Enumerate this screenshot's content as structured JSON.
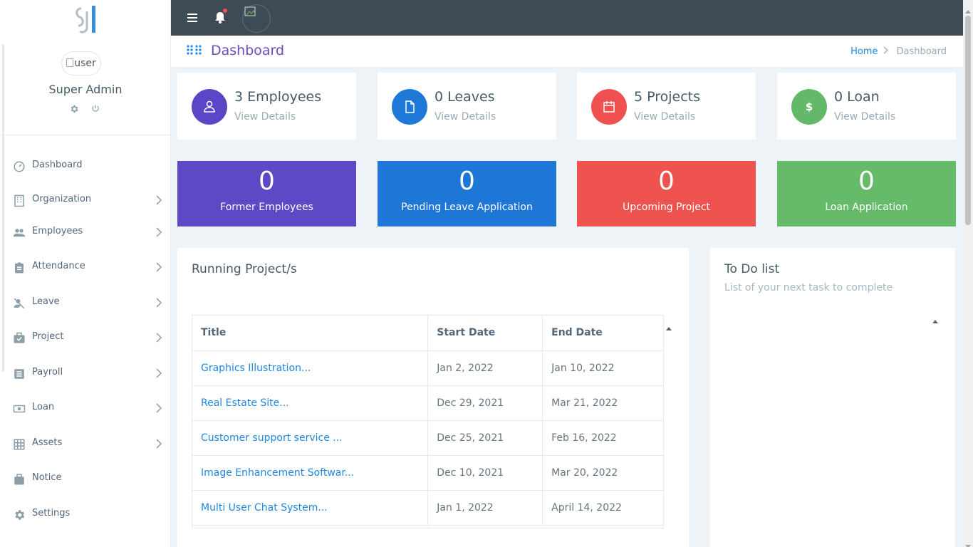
{
  "profile": {
    "avatar_alt": "user",
    "name": "Super Admin"
  },
  "menu": [
    {
      "label": "Dashboard",
      "icon": "dashboard-icon",
      "has_arrow": false
    },
    {
      "label": "Organization",
      "icon": "building-icon",
      "has_arrow": true
    },
    {
      "label": "Employees",
      "icon": "people-icon",
      "has_arrow": true
    },
    {
      "label": "Attendance",
      "icon": "clipboard-icon",
      "has_arrow": true
    },
    {
      "label": "Leave",
      "icon": "person-off-icon",
      "has_arrow": true
    },
    {
      "label": "Project",
      "icon": "briefcase-check-icon",
      "has_arrow": true
    },
    {
      "label": "Payroll",
      "icon": "receipt-icon",
      "has_arrow": true
    },
    {
      "label": "Loan",
      "icon": "money-icon",
      "has_arrow": true
    },
    {
      "label": "Assets",
      "icon": "grid-icon",
      "has_arrow": true
    },
    {
      "label": "Notice",
      "icon": "bag-icon",
      "has_arrow": false
    },
    {
      "label": "Settings",
      "icon": "gear-icon",
      "has_arrow": false
    }
  ],
  "page": {
    "title": "Dashboard"
  },
  "breadcrumb": {
    "home": "Home",
    "current": "Dashboard"
  },
  "stats": [
    {
      "title": "3 Employees",
      "link": "View Details",
      "color": "#5c46c7",
      "icon": "user-icon"
    },
    {
      "title": "0 Leaves",
      "link": "View Details",
      "color": "#1e78d7",
      "icon": "document-icon"
    },
    {
      "title": "5 Projects",
      "link": "View Details",
      "color": "#ef5050",
      "icon": "calendar-icon"
    },
    {
      "title": "0 Loan",
      "link": "View Details",
      "color": "#63b86a",
      "icon": "dollar-icon"
    }
  ],
  "tiles": [
    {
      "value": "0",
      "label": "Former Employees",
      "color": "#5e48c6"
    },
    {
      "value": "0",
      "label": "Pending Leave Application",
      "color": "#1e76d6"
    },
    {
      "value": "0",
      "label": "Upcoming Project",
      "color": "#ef5350"
    },
    {
      "value": "0",
      "label": "Loan Application",
      "color": "#66bb6a"
    }
  ],
  "projects": {
    "title": "Running Project/s",
    "columns": [
      "Title",
      "Start Date",
      "End Date"
    ],
    "rows": [
      {
        "title": "Graphics Illustration...",
        "start": "Jan 2, 2022",
        "end": "Jan 10, 2022"
      },
      {
        "title": "Real Estate Site...",
        "start": "Dec 29, 2021",
        "end": "Mar 21, 2022"
      },
      {
        "title": "Customer support service ...",
        "start": "Dec 25, 2021",
        "end": "Feb 16, 2022"
      },
      {
        "title": "Image Enhancement Softwar...",
        "start": "Dec 10, 2021",
        "end": "Mar 20, 2022"
      },
      {
        "title": "Multi User Chat System...",
        "start": "Jan 1, 2022",
        "end": "April 14, 2022"
      }
    ]
  },
  "todo": {
    "title": "To Do list",
    "subtitle": "List of your next task to complete"
  }
}
